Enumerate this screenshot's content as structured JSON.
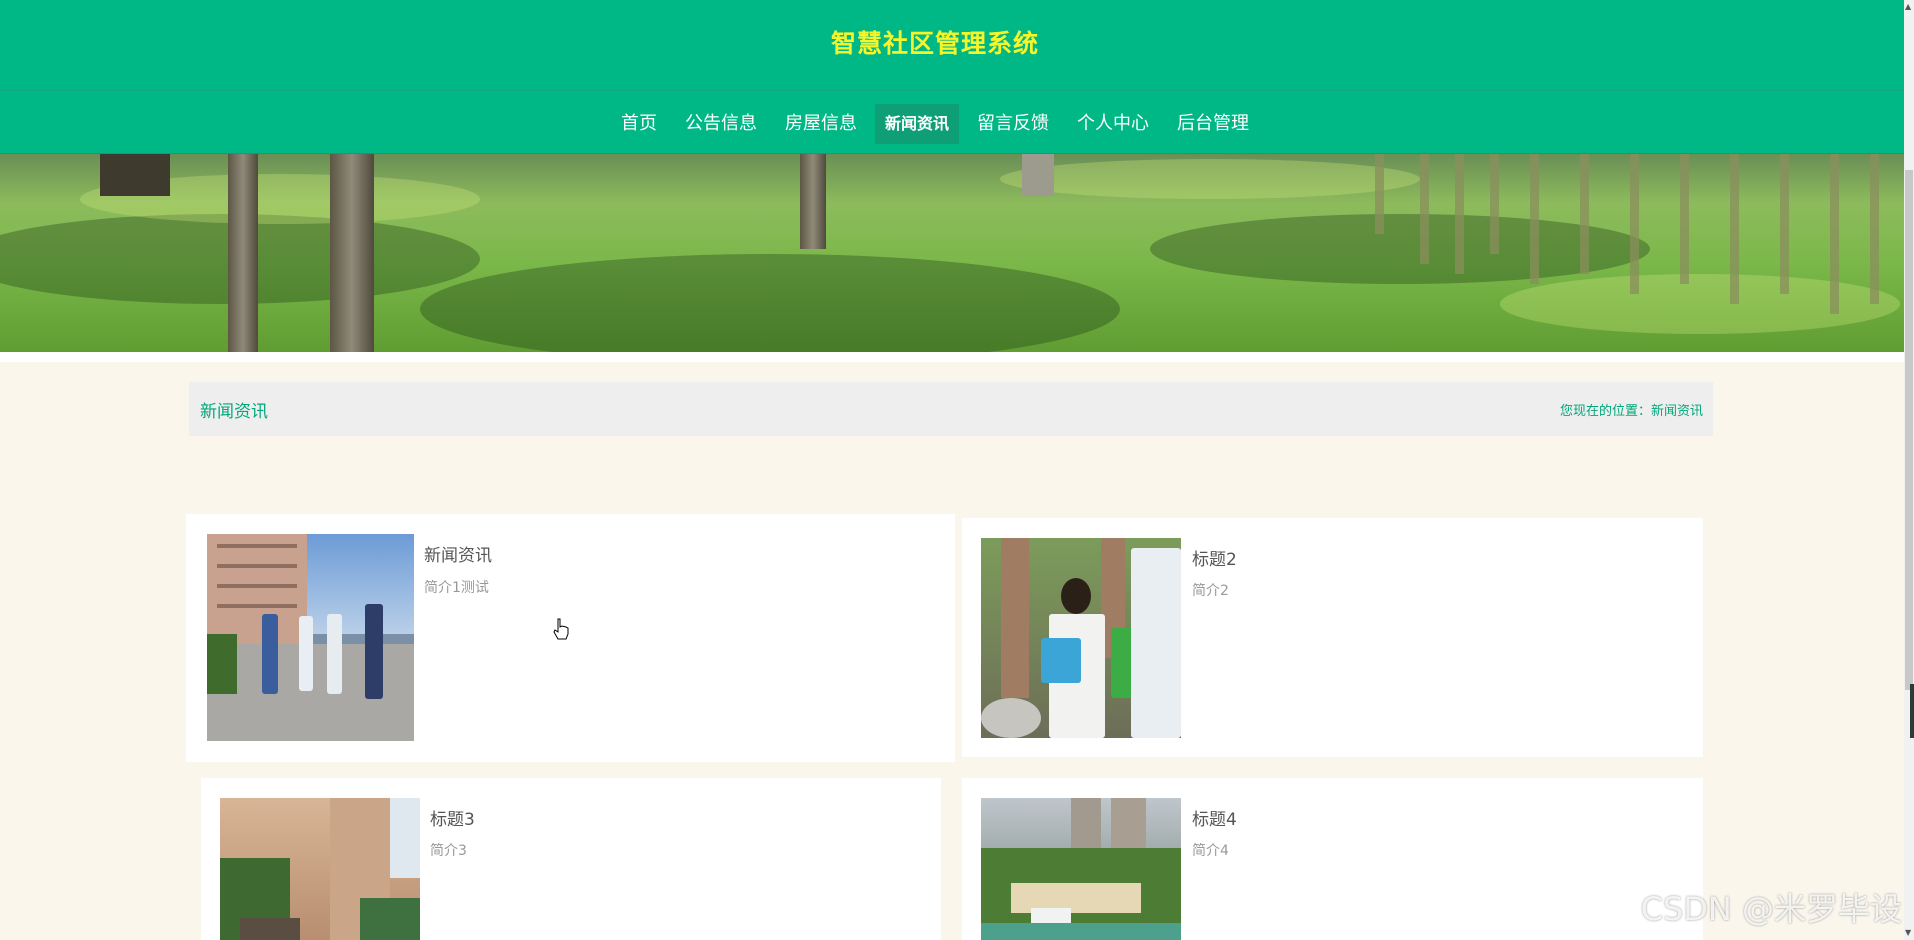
{
  "site": {
    "title": "智慧社区管理系统"
  },
  "nav": {
    "items": [
      {
        "label": "首页",
        "active": false
      },
      {
        "label": "公告信息",
        "active": false
      },
      {
        "label": "房屋信息",
        "active": false
      },
      {
        "label": "新闻资讯",
        "active": true
      },
      {
        "label": "留言反馈",
        "active": false
      },
      {
        "label": "个人中心",
        "active": false
      },
      {
        "label": "后台管理",
        "active": false
      }
    ]
  },
  "section": {
    "title": "新闻资讯",
    "breadcrumb": "您现在的位置：新闻资讯"
  },
  "news": [
    {
      "title": "新闻资讯",
      "summary": "简介1测试"
    },
    {
      "title": "标题2",
      "summary": "简介2"
    },
    {
      "title": "标题3",
      "summary": "简介3"
    },
    {
      "title": "标题4",
      "summary": "简介4"
    }
  ],
  "watermark": "CSDN @米罗毕设",
  "colors": {
    "primary": "#00b786",
    "title": "#f5f52a",
    "active_nav": "#0f9f76",
    "page_bg": "#faf6ec"
  }
}
